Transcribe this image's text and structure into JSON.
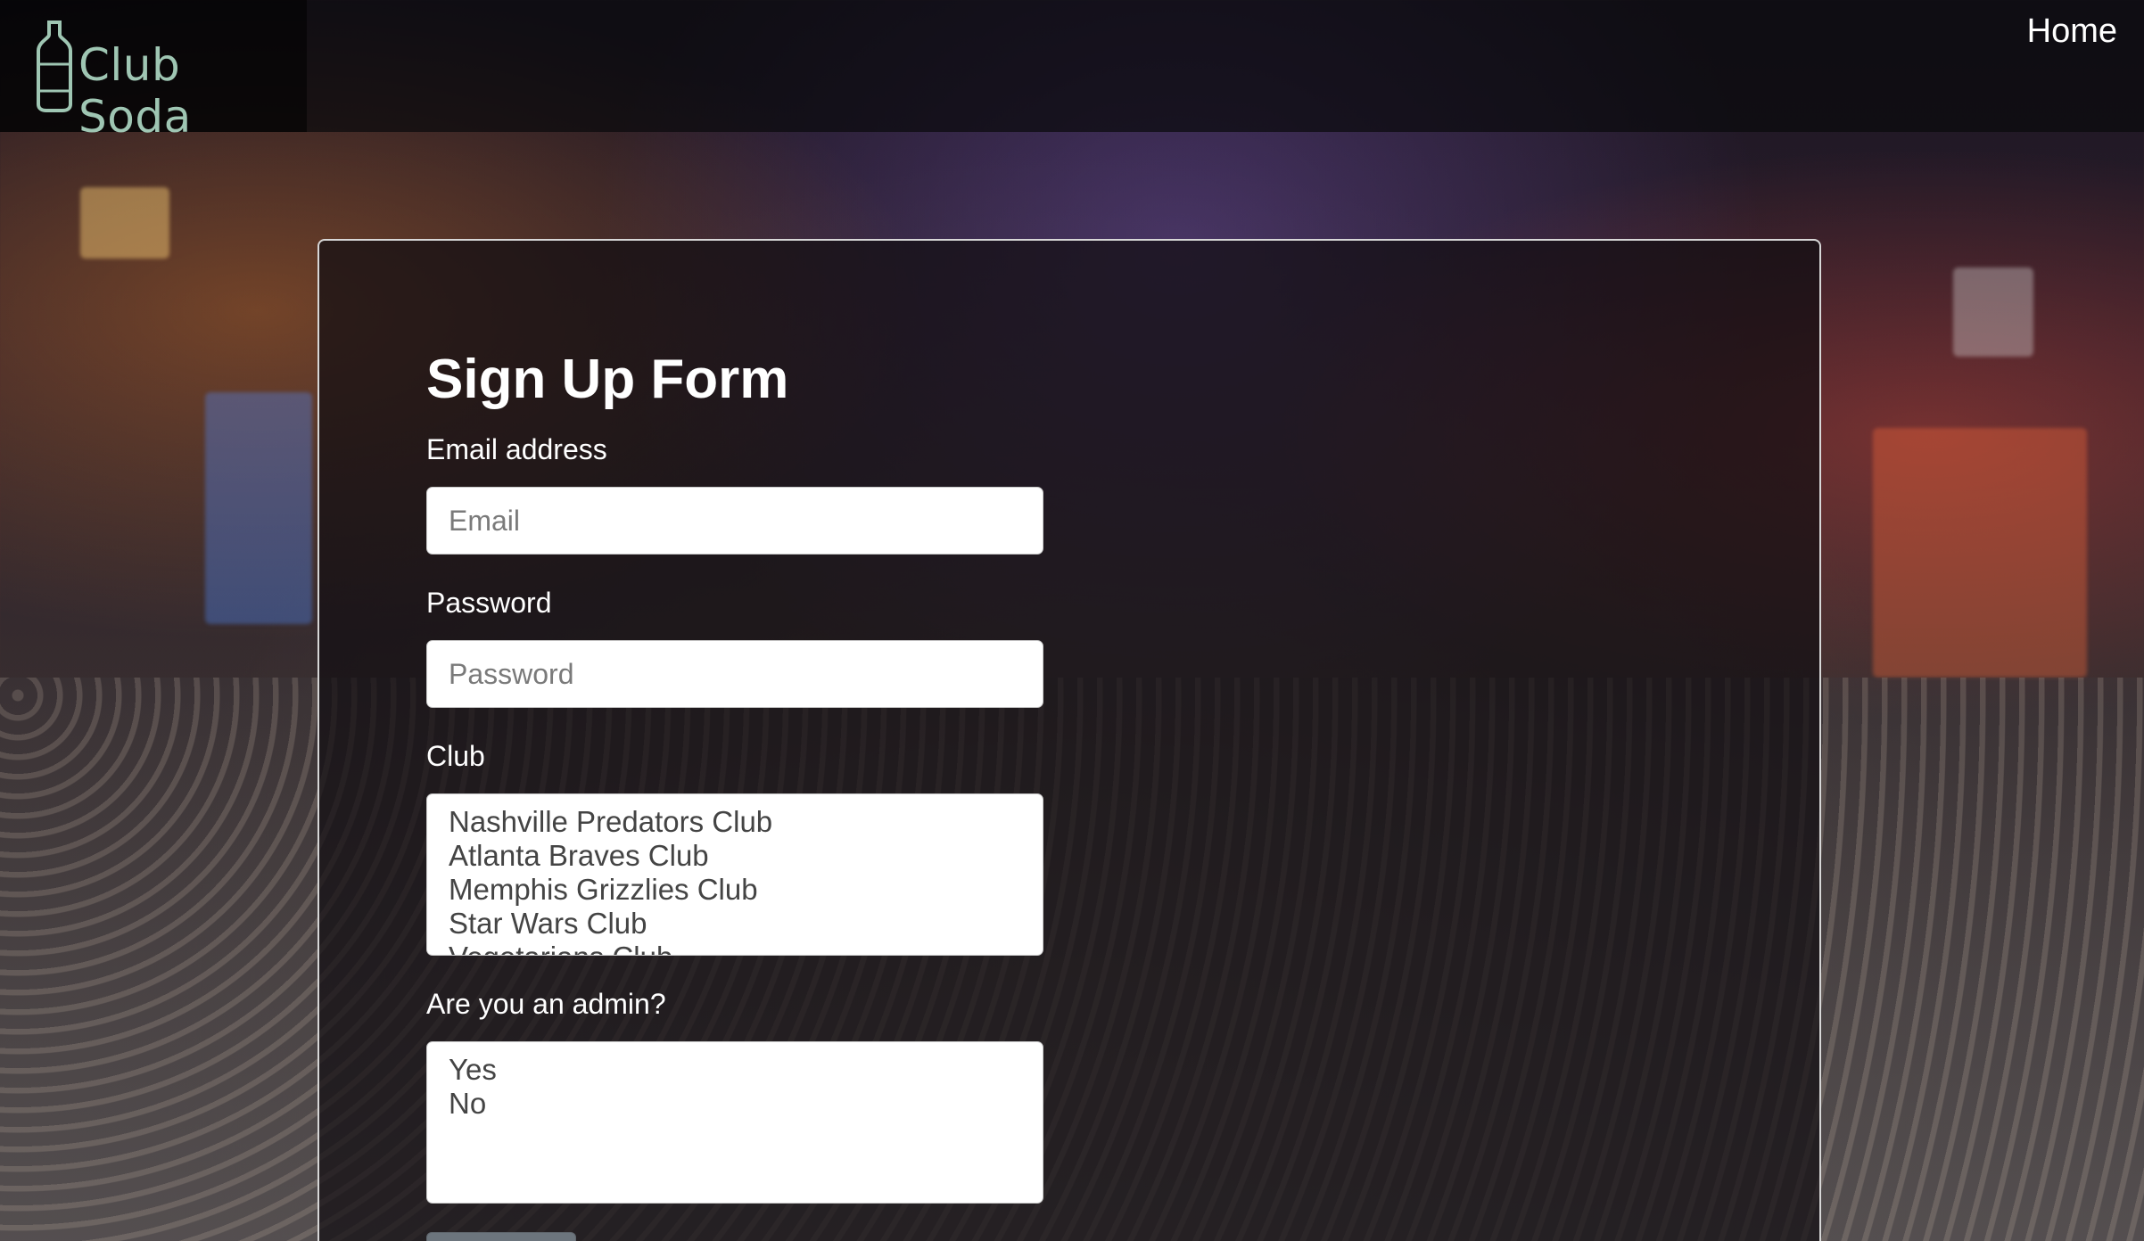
{
  "navbar": {
    "brand": "Club Soda",
    "brand_icon": "bottle-icon",
    "home_link": "Home"
  },
  "form": {
    "title": "Sign Up Form",
    "email": {
      "label": "Email address",
      "placeholder": "Email",
      "value": ""
    },
    "password": {
      "label": "Password",
      "placeholder": "Password",
      "value": ""
    },
    "club": {
      "label": "Club",
      "options": [
        "Nashville Predators Club",
        "Atlanta Braves Club",
        "Memphis Grizzlies Club",
        "Star Wars Club",
        "Vegetarians Club"
      ]
    },
    "admin": {
      "label": "Are you an admin?",
      "options": [
        "Yes",
        "No"
      ]
    }
  },
  "colors": {
    "brand": "#9fc6b3",
    "card_border": "#d7d7d7",
    "button": "#6c757d"
  }
}
